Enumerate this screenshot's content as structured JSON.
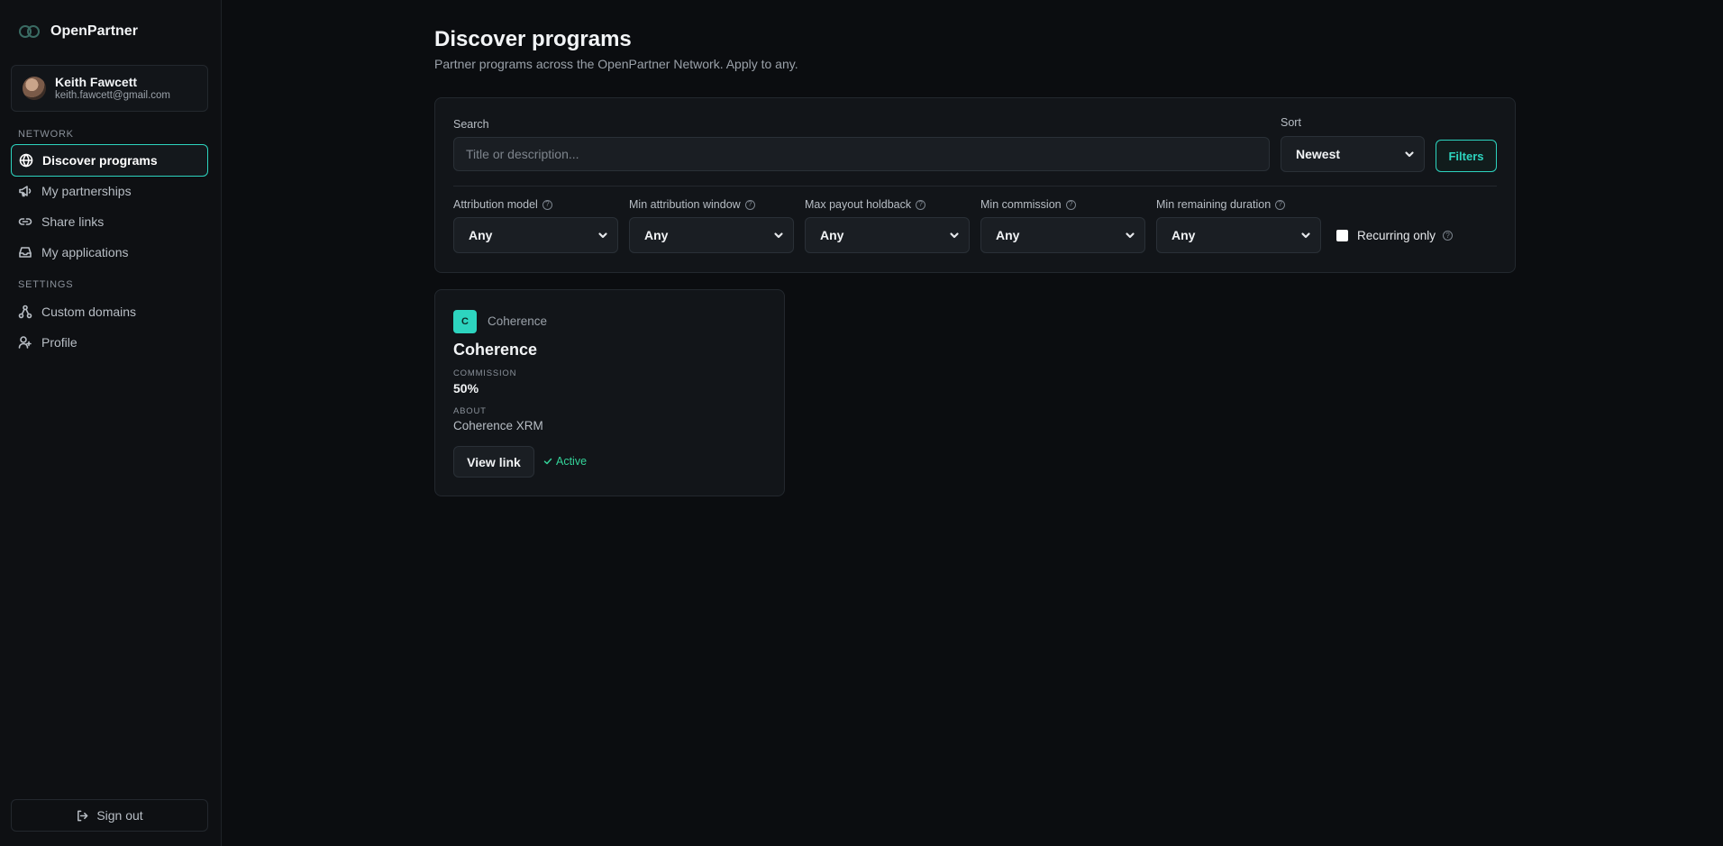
{
  "brand": {
    "name": "OpenPartner"
  },
  "user": {
    "name": "Keith Fawcett",
    "email": "keith.fawcett@gmail.com"
  },
  "sidebar": {
    "network_label": "NETWORK",
    "network_items": [
      {
        "label": "Discover programs",
        "icon": "globe-icon",
        "active": true
      },
      {
        "label": "My partnerships",
        "icon": "megaphone-icon"
      },
      {
        "label": "Share links",
        "icon": "link-icon"
      },
      {
        "label": "My applications",
        "icon": "inbox-icon"
      }
    ],
    "settings_label": "SETTINGS",
    "settings_items": [
      {
        "label": "Custom domains",
        "icon": "network-icon"
      },
      {
        "label": "Profile",
        "icon": "user-icon"
      }
    ],
    "signout_label": "Sign out"
  },
  "header": {
    "title": "Discover programs",
    "subtitle": "Partner programs across the OpenPartner Network. Apply to any."
  },
  "filters": {
    "search_label": "Search",
    "search_placeholder": "Title or description...",
    "search_value": "",
    "sort_label": "Sort",
    "sort_value": "Newest",
    "filters_button": "Filters",
    "fields": [
      {
        "label": "Attribution model",
        "value": "Any"
      },
      {
        "label": "Min attribution window",
        "value": "Any"
      },
      {
        "label": "Max payout holdback",
        "value": "Any"
      },
      {
        "label": "Min commission",
        "value": "Any"
      },
      {
        "label": "Min remaining duration",
        "value": "Any"
      }
    ],
    "recurring_label": "Recurring only",
    "recurring_checked": false
  },
  "programs": [
    {
      "logo_letter": "C",
      "company": "Coherence",
      "title": "Coherence",
      "commission_label": "COMMISSION",
      "commission": "50%",
      "about_label": "ABOUT",
      "about": "Coherence XRM",
      "button": "View link",
      "status": "Active"
    }
  ],
  "colors": {
    "accent": "#2dd4bf",
    "status_active": "#34d399",
    "background": "#0b0d10"
  }
}
